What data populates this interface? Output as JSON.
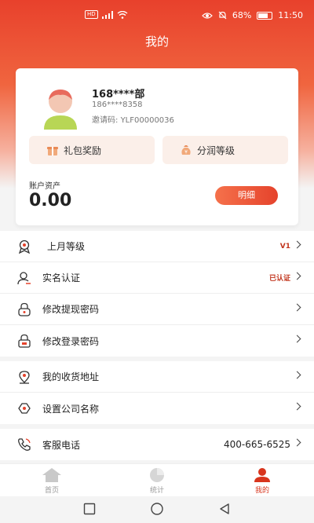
{
  "status": {
    "time": "11:50",
    "battery": "68%",
    "hd": "HD"
  },
  "header": {
    "title": "我的"
  },
  "profile": {
    "username": "168****部",
    "phone": "186****8358",
    "invite_label": "邀请码:",
    "invite_code": "YLF00000036"
  },
  "quick_actions": [
    {
      "label": "礼包奖励",
      "icon": "gift-icon"
    },
    {
      "label": "分润等级",
      "icon": "money-bag-icon"
    }
  ],
  "assets": {
    "label": "账户资产",
    "value": "0.00",
    "detail_button": "明细"
  },
  "menu_group_1": [
    {
      "label": "上月等级",
      "value": "V1",
      "icon": "level-badge-icon"
    },
    {
      "label": "实名认证",
      "value": "已认证",
      "icon": "user-verify-icon"
    },
    {
      "label": "修改提现密码",
      "value": "",
      "icon": "lock-icon"
    },
    {
      "label": "修改登录密码",
      "value": "",
      "icon": "padlock-icon"
    }
  ],
  "menu_group_2": [
    {
      "label": "我的收货地址",
      "icon": "location-icon"
    },
    {
      "label": "设置公司名称",
      "icon": "company-icon"
    }
  ],
  "menu_group_3": [
    {
      "label": "客服电话",
      "value": "400-665-6525",
      "icon": "phone-icon"
    }
  ],
  "tabs": [
    {
      "label": "首页",
      "icon": "home-icon",
      "active": false
    },
    {
      "label": "统计",
      "icon": "pie-chart-icon",
      "active": false
    },
    {
      "label": "我的",
      "icon": "profile-icon",
      "active": true
    }
  ],
  "colors": {
    "accent": "#e5432c",
    "badge_text": "#c2371f"
  }
}
